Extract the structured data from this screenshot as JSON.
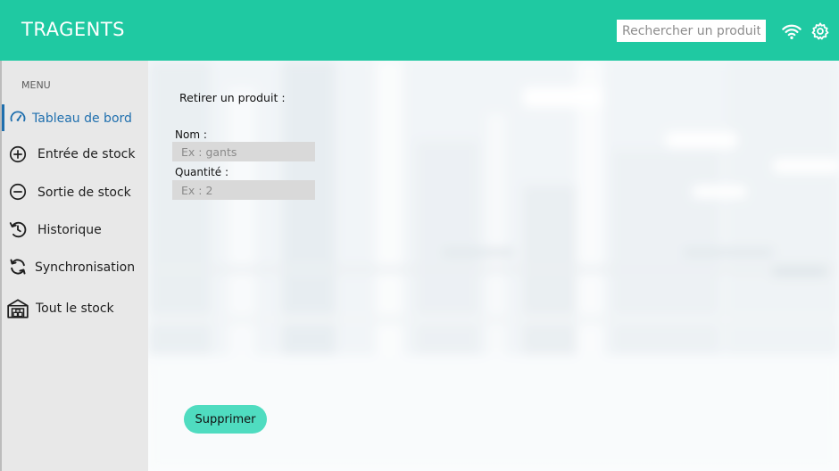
{
  "app": {
    "title": "TRAGENTS"
  },
  "header": {
    "search_placeholder": "Rechercher un produit...",
    "wifi_icon": "wifi-icon",
    "settings_icon": "gear-icon"
  },
  "sidebar": {
    "menu_label": "MENU",
    "items": [
      {
        "label": "Tableau de bord",
        "icon": "speedometer-icon",
        "active": true
      },
      {
        "label": "Entrée de stock",
        "icon": "plus-circle-icon",
        "active": false
      },
      {
        "label": "Sortie de stock",
        "icon": "minus-circle-icon",
        "active": false
      },
      {
        "label": "Historique",
        "icon": "history-icon",
        "active": false
      },
      {
        "label": "Synchronisation",
        "icon": "sync-icon",
        "active": false
      },
      {
        "label": "Tout le stock",
        "icon": "warehouse-icon",
        "active": false
      }
    ]
  },
  "form": {
    "title": "Retirer un produit :",
    "name_label": "Nom :",
    "name_placeholder": "Ex : gants",
    "quantity_label": "Quantité :",
    "quantity_placeholder": "Ex : 2",
    "submit_label": "Supprimer"
  },
  "colors": {
    "accent": "#1fc9a2",
    "button": "#4fdcc0",
    "active_nav": "#1f6fae",
    "sidebar_bg": "#e8e8e8",
    "input_bg": "#d9d9d9"
  }
}
